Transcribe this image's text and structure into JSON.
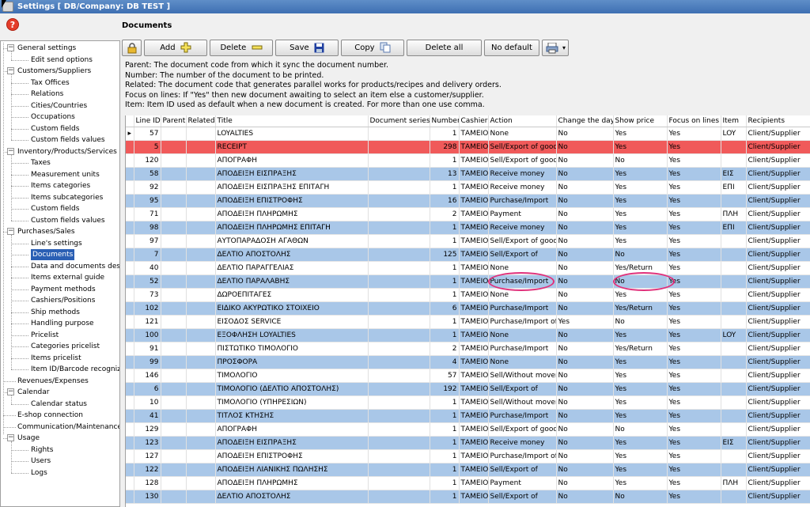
{
  "window": {
    "title": "Settings   [ DB/Company: DB TEST ]"
  },
  "help_label": "?",
  "tree": [
    {
      "label": "General settings",
      "level": 0,
      "expand": "−"
    },
    {
      "label": "Edit send options",
      "level": 1
    },
    {
      "label": "Customers/Suppliers",
      "level": 0,
      "expand": "−"
    },
    {
      "label": "Tax Offices",
      "level": 1
    },
    {
      "label": "Relations",
      "level": 1
    },
    {
      "label": "Cities/Countries",
      "level": 1
    },
    {
      "label": "Occupations",
      "level": 1
    },
    {
      "label": "Custom fields",
      "level": 1
    },
    {
      "label": "Custom fields values",
      "level": 1
    },
    {
      "label": "Inventory/Products/Services",
      "level": 0,
      "expand": "−"
    },
    {
      "label": "Taxes",
      "level": 1
    },
    {
      "label": "Measurement units",
      "level": 1
    },
    {
      "label": "Items categories",
      "level": 1
    },
    {
      "label": "Items subcategories",
      "level": 1
    },
    {
      "label": "Custom fields",
      "level": 1
    },
    {
      "label": "Custom fields values",
      "level": 1
    },
    {
      "label": "Purchases/Sales",
      "level": 0,
      "expand": "−"
    },
    {
      "label": "Line's settings",
      "level": 1
    },
    {
      "label": "Documents",
      "level": 1,
      "selected": true
    },
    {
      "label": "Data and documents desi",
      "level": 1
    },
    {
      "label": "Items external guide",
      "level": 1
    },
    {
      "label": "Payment methods",
      "level": 1
    },
    {
      "label": "Cashiers/Positions",
      "level": 1
    },
    {
      "label": "Ship methods",
      "level": 1
    },
    {
      "label": "Handling purpose",
      "level": 1
    },
    {
      "label": "Pricelist",
      "level": 1
    },
    {
      "label": "Categories pricelist",
      "level": 1
    },
    {
      "label": "Items pricelist",
      "level": 1
    },
    {
      "label": "Item ID/Barcode recognize",
      "level": 1
    },
    {
      "label": "Revenues/Expenses",
      "level": 0
    },
    {
      "label": "Calendar",
      "level": 0,
      "expand": "−"
    },
    {
      "label": "Calendar status",
      "level": 1
    },
    {
      "label": "E-shop connection",
      "level": 0
    },
    {
      "label": "Communication/Maintenance",
      "level": 0
    },
    {
      "label": "Usage",
      "level": 0,
      "expand": "−"
    },
    {
      "label": "Rights",
      "level": 1
    },
    {
      "label": "Users",
      "level": 1
    },
    {
      "label": "Logs",
      "level": 1
    }
  ],
  "main": {
    "title": "Documents",
    "toolbar": {
      "add": "Add",
      "delete": "Delete",
      "save": "Save",
      "copy": "Copy",
      "delete_all": "Delete all",
      "no_default": "No default"
    },
    "info": [
      "Parent: The document code from which it sync the document number.",
      "Number: The number of the document to be printed.",
      "Related: The document code that generates parallel works for products/recipes and delivery orders.",
      "Focus on lines: If \"Yes\" then new document awaiting to select an item else a customer/supplier.",
      "Item: Item ID used as default when a new document is created. For more than one use comma."
    ],
    "columns": [
      "",
      "Line ID",
      "Parent",
      "Related",
      "Title",
      "Document series",
      "Number",
      "Cashier",
      "Action",
      "Change the day",
      "Show price",
      "Focus on lines",
      "Item",
      "Recipients"
    ],
    "rows": [
      {
        "style": "white",
        "cur": true,
        "id": "57",
        "title": "LOYALTIES",
        "number": "1",
        "cashier": "ΤΑΜΕΙΟ",
        "action": "None",
        "change": "No",
        "price": "Yes",
        "focus": "Yes",
        "item": "LOY",
        "recip": "Client/Supplier"
      },
      {
        "style": "red",
        "id": "5",
        "title": "RECEIPT",
        "number": "298",
        "cashier": "ΤΑΜΕΙΟ",
        "action": "Sell/Export of good",
        "change": "No",
        "price": "Yes",
        "focus": "Yes",
        "item": "",
        "recip": "Client/Supplier"
      },
      {
        "style": "white",
        "id": "120",
        "title": "ΑΠΟΓΡΑΦΗ",
        "number": "1",
        "cashier": "ΤΑΜΕΙΟ",
        "action": "Sell/Export of good",
        "change": "No",
        "price": "No",
        "focus": "Yes",
        "item": "",
        "recip": "Client/Supplier"
      },
      {
        "style": "blue",
        "id": "58",
        "title": "ΑΠΟΔΕΙΞΗ ΕΙΣΠΡΑΞΗΣ",
        "number": "13",
        "cashier": "ΤΑΜΕΙΟ",
        "action": "Receive money",
        "change": "No",
        "price": "Yes",
        "focus": "Yes",
        "item": "ΕΙΣ",
        "recip": "Client/Supplier"
      },
      {
        "style": "white",
        "id": "92",
        "title": "ΑΠΟΔΕΙΞΗ ΕΙΣΠΡΑΞΗΣ ΕΠΙΤΑΓΗ",
        "number": "1",
        "cashier": "ΤΑΜΕΙΟ",
        "action": "Receive money",
        "change": "No",
        "price": "Yes",
        "focus": "Yes",
        "item": "ΕΠΙ",
        "recip": "Client/Supplier"
      },
      {
        "style": "blue",
        "id": "95",
        "title": "ΑΠΟΔΕΙΞΗ ΕΠΙΣΤΡΟΦΗΣ",
        "number": "16",
        "cashier": "ΤΑΜΕΙΟ",
        "action": "Purchase/Import",
        "change": "No",
        "price": "Yes",
        "focus": "Yes",
        "item": "",
        "recip": "Client/Supplier"
      },
      {
        "style": "white",
        "id": "71",
        "title": "ΑΠΟΔΕΙΞΗ ΠΛΗΡΩΜΗΣ",
        "number": "2",
        "cashier": "ΤΑΜΕΙΟ",
        "action": "Payment",
        "change": "No",
        "price": "Yes",
        "focus": "Yes",
        "item": "ΠΛΗ",
        "recip": "Client/Supplier"
      },
      {
        "style": "blue",
        "id": "98",
        "title": "ΑΠΟΔΕΙΞΗ ΠΛΗΡΩΜΗΣ ΕΠΙΤΑΓΗ",
        "number": "1",
        "cashier": "ΤΑΜΕΙΟ",
        "action": "Receive money",
        "change": "No",
        "price": "Yes",
        "focus": "Yes",
        "item": "ΕΠΙ",
        "recip": "Client/Supplier"
      },
      {
        "style": "white",
        "id": "97",
        "title": "ΑΥΤΟΠΑΡΑΔΟΣΗ ΑΓΑΘΩΝ",
        "number": "1",
        "cashier": "ΤΑΜΕΙΟ",
        "action": "Sell/Export of good",
        "change": "No",
        "price": "Yes",
        "focus": "Yes",
        "item": "",
        "recip": "Client/Supplier"
      },
      {
        "style": "blue",
        "id": "7",
        "title": "ΔΕΛΤΙΟ ΑΠΟΣΤΟΛΗΣ",
        "number": "125",
        "cashier": "ΤΑΜΕΙΟ",
        "action": "Sell/Export of",
        "change": "No",
        "price": "No",
        "focus": "Yes",
        "item": "",
        "recip": "Client/Supplier"
      },
      {
        "style": "white",
        "id": "40",
        "title": "ΔΕΛΤΙΟ ΠΑΡΑΓΓΕΛΙΑΣ",
        "number": "1",
        "cashier": "ΤΑΜΕΙΟ",
        "action": "None",
        "change": "No",
        "price": "Yes/Return",
        "focus": "Yes",
        "item": "",
        "recip": "Client/Supplier"
      },
      {
        "style": "blue",
        "id": "52",
        "title": "ΔΕΛΤΙΟ ΠΑΡΑΛΑΒΗΣ",
        "number": "1",
        "cashier": "ΤΑΜΕΙΟ",
        "action": "Purchase/Import",
        "change": "No",
        "price": "No",
        "focus": "Yes",
        "item": "",
        "recip": "Client/Supplier"
      },
      {
        "style": "white",
        "id": "73",
        "title": "ΔΩΡΟΕΠΙΤΑΓΕΣ",
        "number": "1",
        "cashier": "ΤΑΜΕΙΟ",
        "action": "None",
        "change": "No",
        "price": "Yes",
        "focus": "Yes",
        "item": "",
        "recip": "Client/Supplier"
      },
      {
        "style": "blue",
        "id": "102",
        "title": "ΕΙΔΙΚΟ ΑΚΥΡΩΤΙΚΟ ΣΤΟΙΧΕΙΟ",
        "number": "6",
        "cashier": "ΤΑΜΕΙΟ",
        "action": "Purchase/Import",
        "change": "No",
        "price": "Yes/Return",
        "focus": "Yes",
        "item": "",
        "recip": "Client/Supplier"
      },
      {
        "style": "white",
        "id": "121",
        "title": "ΕΙΣΟΔΟΣ SERVICE",
        "number": "1",
        "cashier": "ΤΑΜΕΙΟ",
        "action": "Purchase/Import of",
        "change": "Yes",
        "price": "No",
        "focus": "Yes",
        "item": "",
        "recip": "Client/Supplier"
      },
      {
        "style": "blue",
        "id": "100",
        "title": "ΕΞΟΦΛΗΣΗ LOYALTIES",
        "number": "1",
        "cashier": "ΤΑΜΕΙΟ",
        "action": "None",
        "change": "No",
        "price": "Yes",
        "focus": "Yes",
        "item": "LOY",
        "recip": "Client/Supplier"
      },
      {
        "style": "white",
        "id": "91",
        "title": "ΠΙΣΤΩΤΙΚΟ ΤΙΜΟΛΟΓΙΟ",
        "number": "2",
        "cashier": "ΤΑΜΕΙΟ",
        "action": "Purchase/Import",
        "change": "No",
        "price": "Yes/Return",
        "focus": "Yes",
        "item": "",
        "recip": "Client/Supplier"
      },
      {
        "style": "blue",
        "id": "99",
        "title": "ΠΡΟΣΦΟΡΑ",
        "number": "4",
        "cashier": "ΤΑΜΕΙΟ",
        "action": "None",
        "change": "No",
        "price": "Yes",
        "focus": "Yes",
        "item": "",
        "recip": "Client/Supplier"
      },
      {
        "style": "white",
        "id": "146",
        "title": "ΤΙΜΟΛΟΓΙΟ",
        "number": "57",
        "cashier": "ΤΑΜΕΙΟ",
        "action": "Sell/Without movem",
        "change": "No",
        "price": "Yes",
        "focus": "Yes",
        "item": "",
        "recip": "Client/Supplier"
      },
      {
        "style": "blue",
        "id": "6",
        "title": "ΤΙΜΟΛΟΓΙΟ (ΔΕΛΤΙΟ ΑΠΟΣΤΟΛΗΣ)",
        "number": "192",
        "cashier": "ΤΑΜΕΙΟ",
        "action": "Sell/Export of",
        "change": "No",
        "price": "Yes",
        "focus": "Yes",
        "item": "",
        "recip": "Client/Supplier"
      },
      {
        "style": "white",
        "id": "10",
        "title": "ΤΙΜΟΛΟΓΙΟ (ΥΠΗΡΕΣΙΩΝ)",
        "number": "1",
        "cashier": "ΤΑΜΕΙΟ",
        "action": "Sell/Without movem",
        "change": "No",
        "price": "Yes",
        "focus": "Yes",
        "item": "",
        "recip": "Client/Supplier"
      },
      {
        "style": "blue",
        "id": "41",
        "title": "ΤΙΤΛΟΣ ΚΤΗΣΗΣ",
        "number": "1",
        "cashier": "ΤΑΜΕΙΟ",
        "action": "Purchase/Import",
        "change": "No",
        "price": "Yes",
        "focus": "Yes",
        "item": "",
        "recip": "Client/Supplier"
      },
      {
        "style": "white",
        "id": "129",
        "title": "ΑΠΟΓΡΑΦΗ",
        "number": "1",
        "cashier": "ΤΑΜΕΙΟ",
        "action": "Sell/Export of good",
        "change": "No",
        "price": "No",
        "focus": "Yes",
        "item": "",
        "recip": "Client/Supplier"
      },
      {
        "style": "blue",
        "id": "123",
        "title": "ΑΠΟΔΕΙΞΗ ΕΙΣΠΡΑΞΗΣ",
        "number": "1",
        "cashier": "ΤΑΜΕΙΟ",
        "action": "Receive money",
        "change": "No",
        "price": "Yes",
        "focus": "Yes",
        "item": "ΕΙΣ",
        "recip": "Client/Supplier"
      },
      {
        "style": "white",
        "id": "127",
        "title": "ΑΠΟΔΕΙΞΗ ΕΠΙΣΤΡΟΦΗΣ",
        "number": "1",
        "cashier": "ΤΑΜΕΙΟ",
        "action": "Purchase/Import of",
        "change": "No",
        "price": "Yes",
        "focus": "Yes",
        "item": "",
        "recip": "Client/Supplier"
      },
      {
        "style": "blue",
        "id": "122",
        "title": "ΑΠΟΔΕΙΞΗ ΛΙΑΝΙΚΗΣ ΠΩΛΗΣΗΣ",
        "number": "1",
        "cashier": "ΤΑΜΕΙΟ",
        "action": "Sell/Export of",
        "change": "No",
        "price": "Yes",
        "focus": "Yes",
        "item": "",
        "recip": "Client/Supplier"
      },
      {
        "style": "white",
        "id": "128",
        "title": "ΑΠΟΔΕΙΞΗ ΠΛΗΡΩΜΗΣ",
        "number": "1",
        "cashier": "ΤΑΜΕΙΟ",
        "action": "Payment",
        "change": "No",
        "price": "Yes",
        "focus": "Yes",
        "item": "ΠΛΗ",
        "recip": "Client/Supplier"
      },
      {
        "style": "blue",
        "id": "130",
        "title": "ΔΕΛΤΙΟ ΑΠΟΣΤΟΛΗΣ",
        "number": "1",
        "cashier": "ΤΑΜΕΙΟ",
        "action": "Sell/Export of",
        "change": "No",
        "price": "No",
        "focus": "Yes",
        "item": "",
        "recip": "Client/Supplier"
      }
    ]
  }
}
